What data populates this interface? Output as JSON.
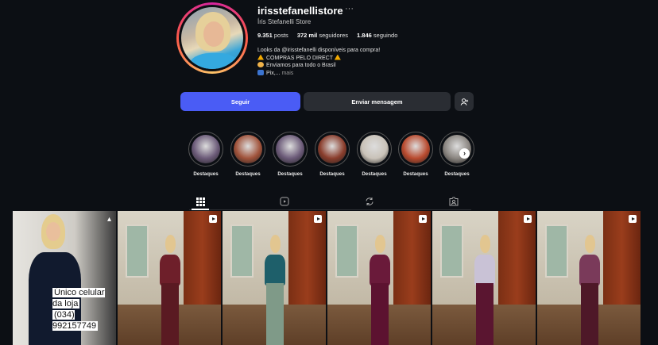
{
  "profile": {
    "username": "irisstefanellistore",
    "more": "···",
    "full_name": "Íris Stefanelli Store",
    "posts_count": "9.351",
    "posts_label": "posts",
    "followers_count": "372 mil",
    "followers_label": "seguidores",
    "following_count": "1.846",
    "following_label": "seguindo",
    "bio": {
      "line1": "Looks da @irisstefanelli disponíveis para compra!",
      "line2": "COMPRAS PELO DIRECT",
      "line3": "Enviamos para todo o Brasil",
      "line4": "Pix,...",
      "more": "mais"
    }
  },
  "actions": {
    "follow": "Seguir",
    "message": "Enviar mensagem"
  },
  "highlights": [
    {
      "label": "Destaques",
      "color": "#6b5a78"
    },
    {
      "label": "Destaques",
      "color": "#a0523a"
    },
    {
      "label": "Destaques",
      "color": "#6b5a78"
    },
    {
      "label": "Destaques",
      "color": "#8a3d2c"
    },
    {
      "label": "Destaques",
      "color": "#c9c2b8"
    },
    {
      "label": "Destaques",
      "color": "#b94a2e"
    },
    {
      "label": "Destaques",
      "color": "#8a8580"
    }
  ],
  "tabs": [
    "posts-grid",
    "reels",
    "reposts",
    "tagged"
  ],
  "posts": [
    {
      "type": "pinned",
      "caption_line1": "Único celular da loja",
      "caption_line2": "(034) 992157749"
    },
    {
      "type": "reel",
      "top": "#6e1f2a",
      "bottom": "#5a1a22"
    },
    {
      "type": "reel",
      "top": "#1e5f6a",
      "bottom": "#7f9a88"
    },
    {
      "type": "reel",
      "top": "#6a1a3a",
      "bottom": "#5c1230"
    },
    {
      "type": "reel",
      "top": "#c9c2d6",
      "bottom": "#5a1530"
    },
    {
      "type": "reel",
      "top": "#7a3a5a",
      "bottom": "#4e1828"
    }
  ]
}
